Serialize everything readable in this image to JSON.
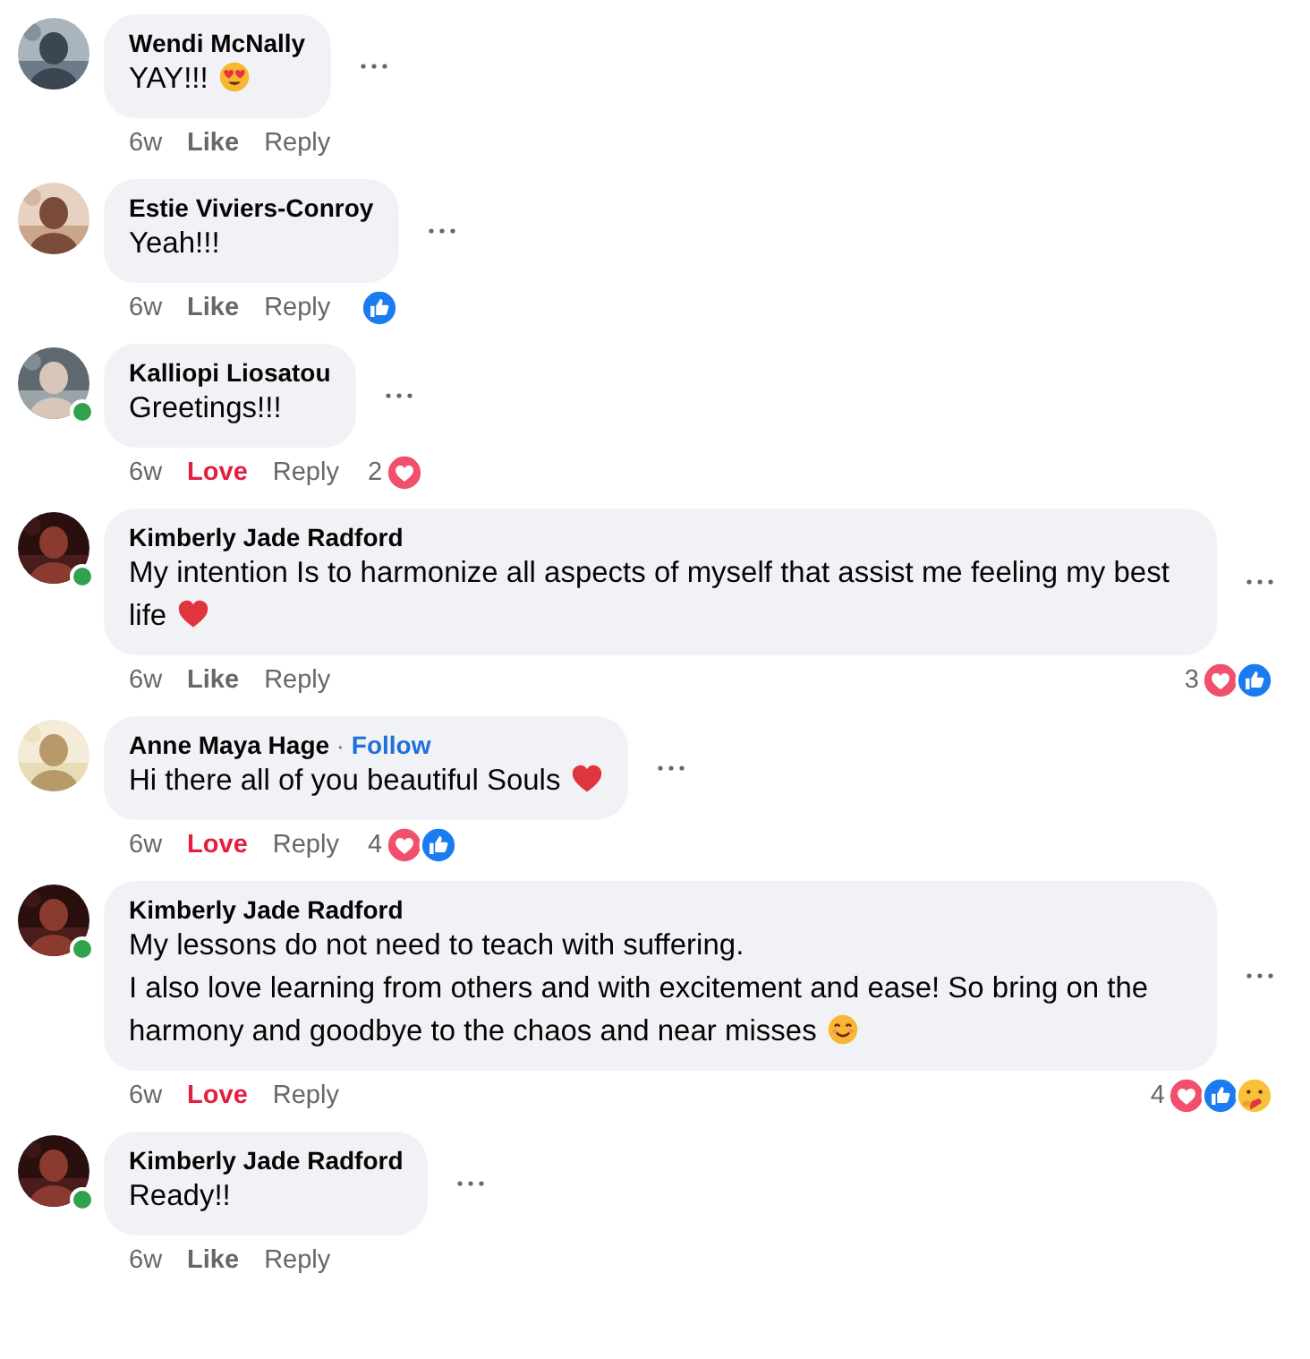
{
  "comments": [
    {
      "author": "Wendi McNally",
      "online": false,
      "paragraphs": [
        [
          {
            "kind": "text",
            "text": "YAY!!!"
          },
          {
            "kind": "heart-eyes"
          }
        ]
      ],
      "time": "6w",
      "action": {
        "label": "Like",
        "kind": "like"
      },
      "reply": "Reply"
    },
    {
      "author": "Estie Viviers-Conroy",
      "online": false,
      "paragraphs": [
        [
          {
            "kind": "text",
            "text": "Yeah!!!"
          }
        ]
      ],
      "time": "6w",
      "action": {
        "label": "Like",
        "kind": "like"
      },
      "reply": "Reply",
      "reactions": {
        "icons": [
          {
            "kind": "like"
          }
        ]
      }
    },
    {
      "author": "Kalliopi Liosatou",
      "online": true,
      "paragraphs": [
        [
          {
            "kind": "text",
            "text": "Greetings!!!"
          }
        ]
      ],
      "time": "6w",
      "action": {
        "label": "Love",
        "kind": "love"
      },
      "reply": "Reply",
      "reactions": {
        "count": "2",
        "icons": [
          {
            "kind": "love"
          }
        ]
      }
    },
    {
      "author": "Kimberly Jade Radford",
      "online": true,
      "paragraphs": [
        [
          {
            "kind": "text",
            "text": "My intention Is to harmonize all aspects of myself that assist me feeling my best life"
          },
          {
            "kind": "heart"
          }
        ]
      ],
      "time": "6w",
      "action": {
        "label": "Like",
        "kind": "like"
      },
      "reply": "Reply",
      "reactions": {
        "count": "3",
        "icons": [
          {
            "kind": "love"
          },
          {
            "kind": "like"
          }
        ]
      }
    },
    {
      "author": "Anne Maya Hage",
      "follow_separator": "·",
      "follow": "Follow",
      "online": false,
      "paragraphs": [
        [
          {
            "kind": "text",
            "text": "Hi there all of you beautiful Souls"
          },
          {
            "kind": "heart"
          }
        ]
      ],
      "time": "6w",
      "action": {
        "label": "Love",
        "kind": "love"
      },
      "reply": "Reply",
      "reactions": {
        "count": "4",
        "icons": [
          {
            "kind": "love"
          },
          {
            "kind": "like"
          }
        ]
      }
    },
    {
      "author": "Kimberly Jade Radford",
      "online": true,
      "paragraphs": [
        [
          {
            "kind": "text",
            "text": "My lessons do not need to teach with suffering."
          }
        ],
        [
          {
            "kind": "text",
            "text": "I also love learning from others and with excitement and ease! So bring on the harmony and goodbye to the chaos and near misses"
          },
          {
            "kind": "smile"
          }
        ]
      ],
      "time": "6w",
      "action": {
        "label": "Love",
        "kind": "love"
      },
      "reply": "Reply",
      "reactions": {
        "count": "4",
        "icons": [
          {
            "kind": "love"
          },
          {
            "kind": "like"
          },
          {
            "kind": "care"
          }
        ]
      }
    },
    {
      "author": "Kimberly Jade Radford",
      "online": true,
      "paragraphs": [
        [
          {
            "kind": "text",
            "text": "Ready!!"
          }
        ]
      ],
      "time": "6w",
      "action": {
        "label": "Like",
        "kind": "like"
      },
      "reply": "Reply"
    }
  ]
}
